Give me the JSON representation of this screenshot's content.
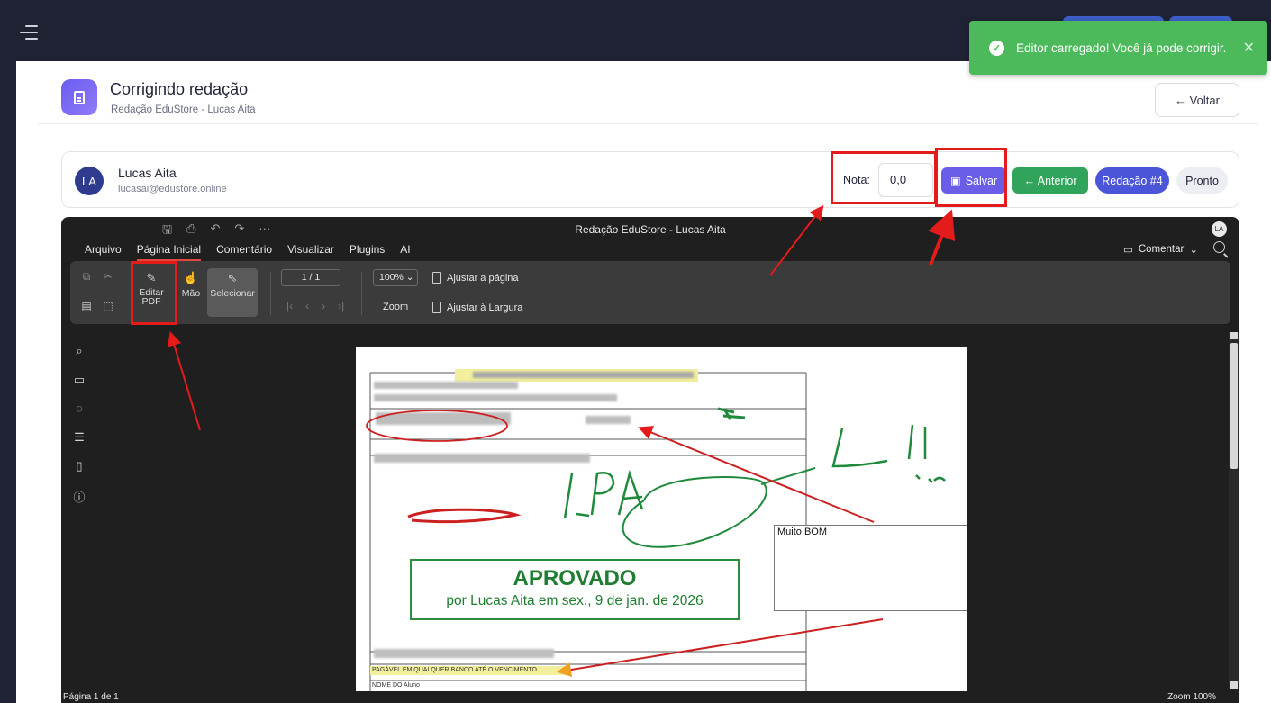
{
  "toast": {
    "message": "Editor carregado! Você já pode corrigir."
  },
  "header": {
    "title": "Corrigindo redação",
    "subtitle": "Redação EduStore - Lucas Aita",
    "back_label": "← Voltar"
  },
  "student": {
    "initials": "LA",
    "name": "Lucas Aita",
    "email": "lucasai@edustore.online",
    "grade_label": "Nota:",
    "grade_value": "0,0",
    "save_label": "Salvar",
    "prev_label": "← Anterior",
    "essay_label": "Redação #4",
    "done_label": "Pronto"
  },
  "viewer": {
    "document_title": "Redação EduStore - Lucas Aita",
    "user_initials": "LA",
    "menus": [
      "Arquivo",
      "Página Inicial",
      "Comentário",
      "Visualizar",
      "Plugins",
      "AI"
    ],
    "comment_menu": "Comentar",
    "toolbar": {
      "edit_pdf": [
        "Editar",
        "PDF"
      ],
      "hand": "Mão",
      "select": "Selecionar",
      "page_indicator": "1 / 1",
      "zoom_value": "100%",
      "zoom_label": "Zoom",
      "fit_page": "Ajustar a página",
      "fit_width": "Ajustar à Largura"
    },
    "sidebar_icons": [
      "search-icon",
      "comment-icon",
      "chat-bubble-icon",
      "outline-icon",
      "page-thumbnail-icon",
      "info-icon"
    ],
    "status": {
      "page": "Página 1 de 1",
      "zoom": "Zoom 100%"
    }
  },
  "document": {
    "stamp_title": "APROVADO",
    "stamp_subtitle": "por Lucas Aita em sex., 9 de jan. de 2026",
    "comment_note": "Muito BOM",
    "handwritten_marks": [
      "LPA",
      "L!!"
    ],
    "footer_line": "PAGÁVEL EM QUALQUER BANCO ATÉ O VENCIMENTO",
    "footer_field": "NOME DO Aluno"
  },
  "colors": {
    "accent": "#6a5ee8",
    "success": "#2fa45a",
    "annotation_red": "#e31b1b",
    "ink_green": "#1f8a3c"
  }
}
